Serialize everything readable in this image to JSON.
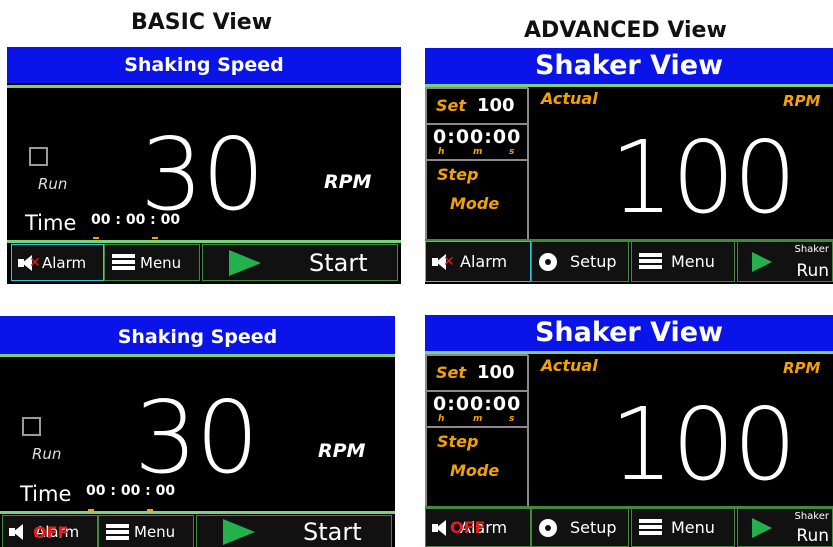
{
  "headings": {
    "basic": "BASIC View",
    "advanced": "ADVANCED View"
  },
  "colors": {
    "header_blue": "#0a14e8",
    "accent_green": "#7cd27c",
    "orange": "#f2a100",
    "play_green": "#22b14c",
    "alarm_red": "#e81a1a"
  },
  "basic": {
    "title": "Shaking Speed",
    "run_label": "Run",
    "speed": "30",
    "unit": "RPM",
    "time_label": "Time",
    "time_value": "00 : 00 : 00",
    "alarm_label": "Alarm",
    "menu_label": "Menu",
    "start_label": "Start",
    "off_label": "OFF"
  },
  "advanced": {
    "title": "Shaker View",
    "set_label": "Set",
    "set_value": "100",
    "time_value": "0:00:00",
    "h": "h",
    "m": "m",
    "s": "s",
    "step_label": "Step",
    "mode_label": "Mode",
    "actual_label": "Actual",
    "unit": "RPM",
    "speed": "100",
    "alarm_label": "Alarm",
    "setup_label": "Setup",
    "menu_label": "Menu",
    "shaker_label": "Shaker",
    "run_label": "Run",
    "off_label": "OFF"
  }
}
